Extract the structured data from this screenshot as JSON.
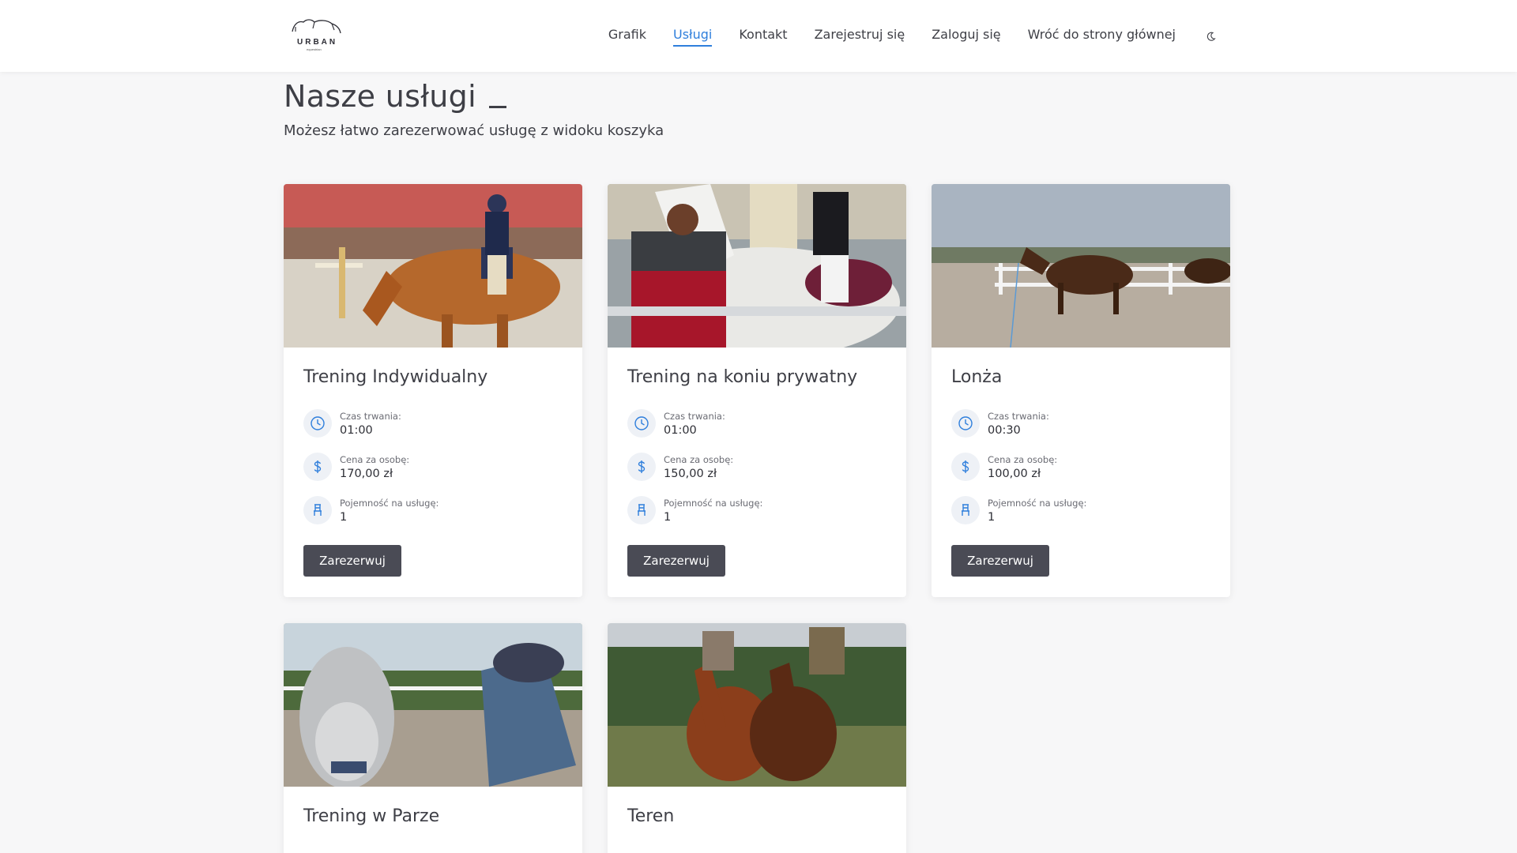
{
  "header": {
    "logo_text": "URBAN",
    "logo_sub": "equestrian",
    "nav": [
      {
        "label": "Grafik",
        "active": false
      },
      {
        "label": "Usługi",
        "active": true
      },
      {
        "label": "Kontakt",
        "active": false
      },
      {
        "label": "Zarejestruj się",
        "active": false
      },
      {
        "label": "Zaloguj się",
        "active": false
      },
      {
        "label": "Wróć do strony głównej",
        "active": false
      }
    ]
  },
  "page": {
    "title": "Nasze usługi",
    "subtitle": "Możesz łatwo zarezerwować usługę z widoku koszyka"
  },
  "labels": {
    "duration": "Czas trwania:",
    "price": "Cena za osobę:",
    "capacity": "Pojemność na usługę:",
    "reserve": "Zarezerwuj"
  },
  "services": [
    {
      "title": "Trening Indywidualny",
      "duration": "01:00",
      "price": "170,00 zł",
      "capacity": "1"
    },
    {
      "title": "Trening na koniu prywatny",
      "duration": "01:00",
      "price": "150,00 zł",
      "capacity": "1"
    },
    {
      "title": "Lonża",
      "duration": "00:30",
      "price": "100,00 zł",
      "capacity": "1"
    },
    {
      "title": "Trening w Parze",
      "duration": "",
      "price": "",
      "capacity": ""
    },
    {
      "title": "Teren",
      "duration": "",
      "price": "",
      "capacity": ""
    }
  ],
  "colors": {
    "accent": "#2f7fdc",
    "button": "#4a4b55",
    "background": "#f7f7f8",
    "text": "#3e3f46"
  },
  "icons": {
    "duration": "clock-icon",
    "price": "dollar-icon",
    "capacity": "chair-icon",
    "theme": "moon-icon"
  }
}
